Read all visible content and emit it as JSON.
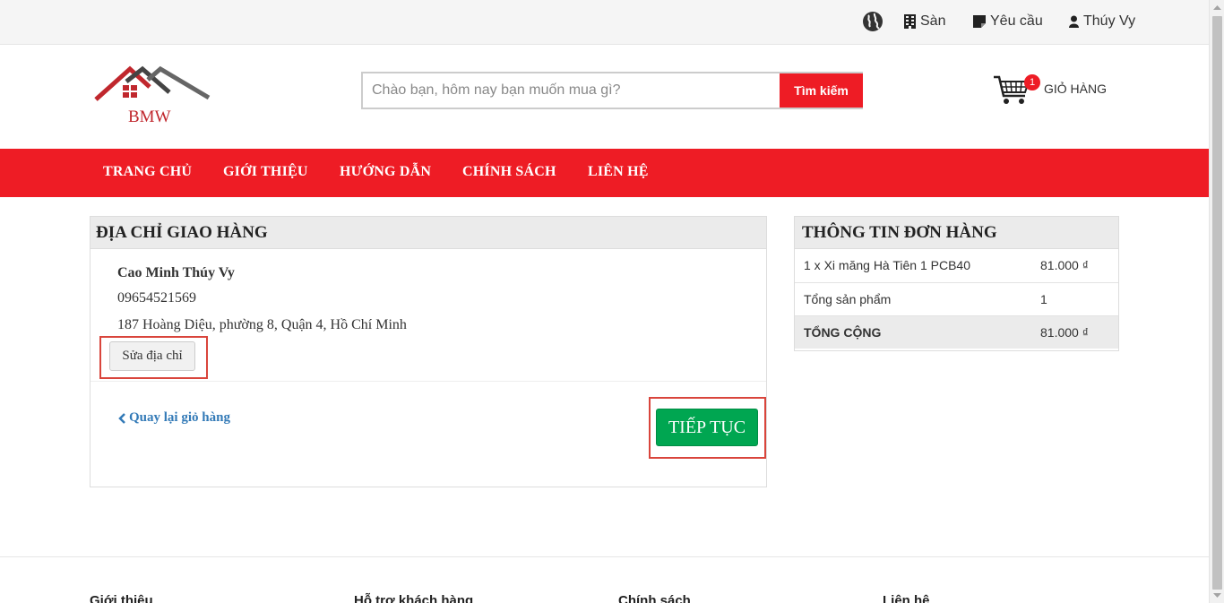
{
  "topbar": {
    "items": [
      {
        "label": "Sàn",
        "icon": "building-icon"
      },
      {
        "label": "Yêu cầu",
        "icon": "note-icon"
      },
      {
        "label": "Thúy Vy",
        "icon": "user-icon"
      }
    ]
  },
  "logo": {
    "text": "BMW"
  },
  "search": {
    "placeholder": "Chào bạn, hôm nay bạn muốn mua gì?",
    "button_label": "Tìm kiếm"
  },
  "cart": {
    "count": "1",
    "label": "GIỎ HÀNG"
  },
  "nav": {
    "items": [
      "TRANG CHỦ",
      "GIỚI THIỆU",
      "HƯỚNG DẪN",
      "CHÍNH SÁCH",
      "LIÊN HỆ"
    ]
  },
  "shipping": {
    "title": "ĐỊA CHỈ GIAO HÀNG",
    "name": "Cao Minh Thúy Vy",
    "phone": "09654521569",
    "address": "187 Hoàng Diệu, phường 8, Quận 4, Hồ Chí Minh",
    "edit_label": "Sửa địa chỉ",
    "back_label": "Quay lại giỏ hàng",
    "continue_label": "TIẾP TỤC"
  },
  "order": {
    "title": "THÔNG TIN ĐƠN HÀNG",
    "rows": [
      {
        "label": "1 x Xi măng Hà Tiên 1 PCB40",
        "value": "81.000 ₫"
      },
      {
        "label": "Tổng sản phẩm",
        "value": "1"
      }
    ],
    "total_label": "TỔNG CỘNG",
    "total_value": "81.000 ₫"
  },
  "footer": {
    "columns": [
      "Giới thiệu",
      "Hỗ trợ khách hàng",
      "Chính sách",
      "Liên hệ"
    ]
  },
  "colors": {
    "brand_red": "#ee1c25",
    "continue_green": "#00a651",
    "link_blue": "#337ab7",
    "highlight": "#d9453c"
  }
}
